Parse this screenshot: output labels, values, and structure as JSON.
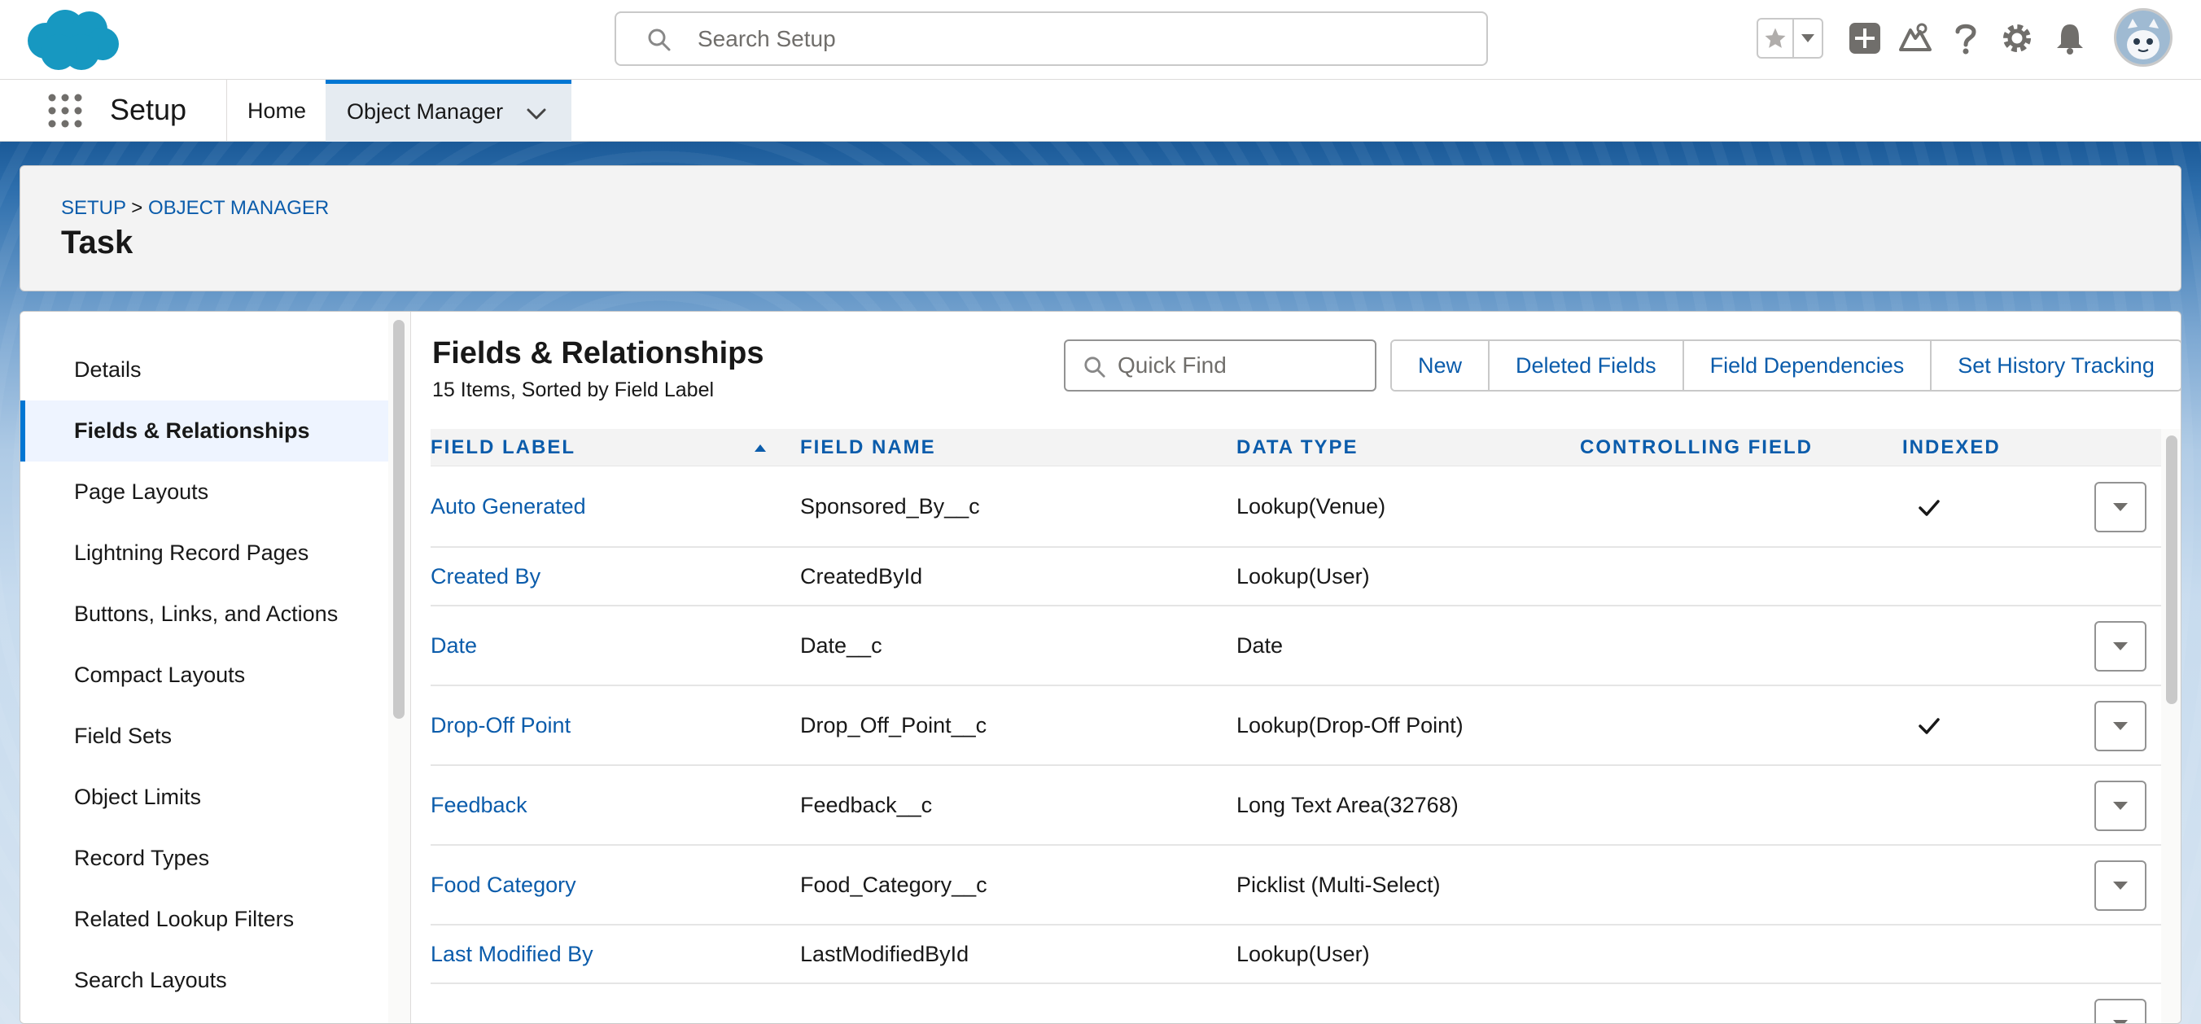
{
  "header": {
    "search_placeholder": "Search Setup",
    "icons": [
      "favorites-star-icon",
      "favorites-dropdown-icon",
      "global-actions-icon",
      "trailhead-icon",
      "help-icon",
      "setup-gear-icon",
      "notifications-bell-icon",
      "user-avatar-icon"
    ],
    "brand_color": "#1798c1"
  },
  "nav": {
    "app_name": "Setup",
    "tabs": [
      {
        "label": "Home"
      },
      {
        "label": "Object Manager",
        "active": true
      }
    ]
  },
  "page_header": {
    "breadcrumb": [
      "SETUP",
      "OBJECT MANAGER"
    ],
    "breadcrumb_separator": ">",
    "title": "Task"
  },
  "sidebar": {
    "items": [
      {
        "label": "Details"
      },
      {
        "label": "Fields & Relationships",
        "active": true
      },
      {
        "label": "Page Layouts"
      },
      {
        "label": "Lightning Record Pages"
      },
      {
        "label": "Buttons, Links, and Actions"
      },
      {
        "label": "Compact Layouts"
      },
      {
        "label": "Field Sets"
      },
      {
        "label": "Object Limits"
      },
      {
        "label": "Record Types"
      },
      {
        "label": "Related Lookup Filters"
      },
      {
        "label": "Search Layouts"
      }
    ]
  },
  "main": {
    "title": "Fields & Relationships",
    "subtitle": "15 Items, Sorted by Field Label",
    "quick_find_placeholder": "Quick Find",
    "buttons": [
      "New",
      "Deleted Fields",
      "Field Dependencies",
      "Set History Tracking"
    ],
    "table": {
      "columns": [
        "FIELD LABEL",
        "FIELD NAME",
        "DATA TYPE",
        "CONTROLLING FIELD",
        "INDEXED"
      ],
      "sorted_by": "FIELD LABEL",
      "rows": [
        {
          "label": "Auto Generated",
          "name": "Sponsored_By__c",
          "type": "Lookup(Venue)",
          "controlling": "",
          "indexed": true,
          "menu": true
        },
        {
          "label": "Created By",
          "name": "CreatedById",
          "type": "Lookup(User)",
          "controlling": "",
          "indexed": false,
          "menu": false
        },
        {
          "label": "Date",
          "name": "Date__c",
          "type": "Date",
          "controlling": "",
          "indexed": false,
          "menu": true
        },
        {
          "label": "Drop-Off Point",
          "name": "Drop_Off_Point__c",
          "type": "Lookup(Drop-Off Point)",
          "controlling": "",
          "indexed": true,
          "menu": true
        },
        {
          "label": "Feedback",
          "name": "Feedback__c",
          "type": "Long Text Area(32768)",
          "controlling": "",
          "indexed": false,
          "menu": true
        },
        {
          "label": "Food Category",
          "name": "Food_Category__c",
          "type": "Picklist (Multi-Select)",
          "controlling": "",
          "indexed": false,
          "menu": true
        },
        {
          "label": "Last Modified By",
          "name": "LastModifiedById",
          "type": "Lookup(User)",
          "controlling": "",
          "indexed": false,
          "menu": false
        }
      ]
    }
  }
}
